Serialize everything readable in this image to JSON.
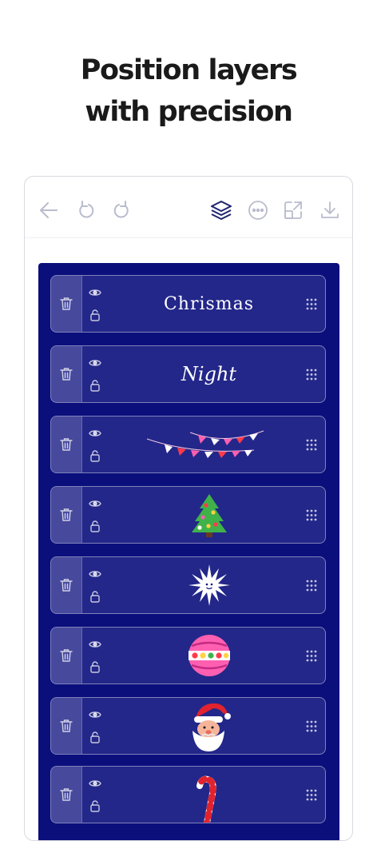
{
  "headline": {
    "line1": "Position layers",
    "line2": "with precision"
  },
  "toolbar": {
    "icons": [
      "back-arrow-icon",
      "undo-icon",
      "redo-icon",
      "layers-icon",
      "more-options-icon",
      "resize-icon",
      "download-icon"
    ],
    "active_icon": "layers-icon",
    "active_color": "#1e2470",
    "inactive_color": "#b9bccd"
  },
  "canvas": {
    "background_color": "#0b0f7c"
  },
  "layers": [
    {
      "type": "text",
      "text": "Chrismas"
    },
    {
      "type": "text",
      "text": "Night"
    },
    {
      "type": "image",
      "icon": "bunting-flags-icon"
    },
    {
      "type": "image",
      "icon": "christmas-tree-icon"
    },
    {
      "type": "image",
      "icon": "star-sun-icon"
    },
    {
      "type": "image",
      "icon": "ornament-ball-icon"
    },
    {
      "type": "image",
      "icon": "santa-face-icon"
    },
    {
      "type": "image",
      "icon": "candy-cane-icon"
    }
  ]
}
